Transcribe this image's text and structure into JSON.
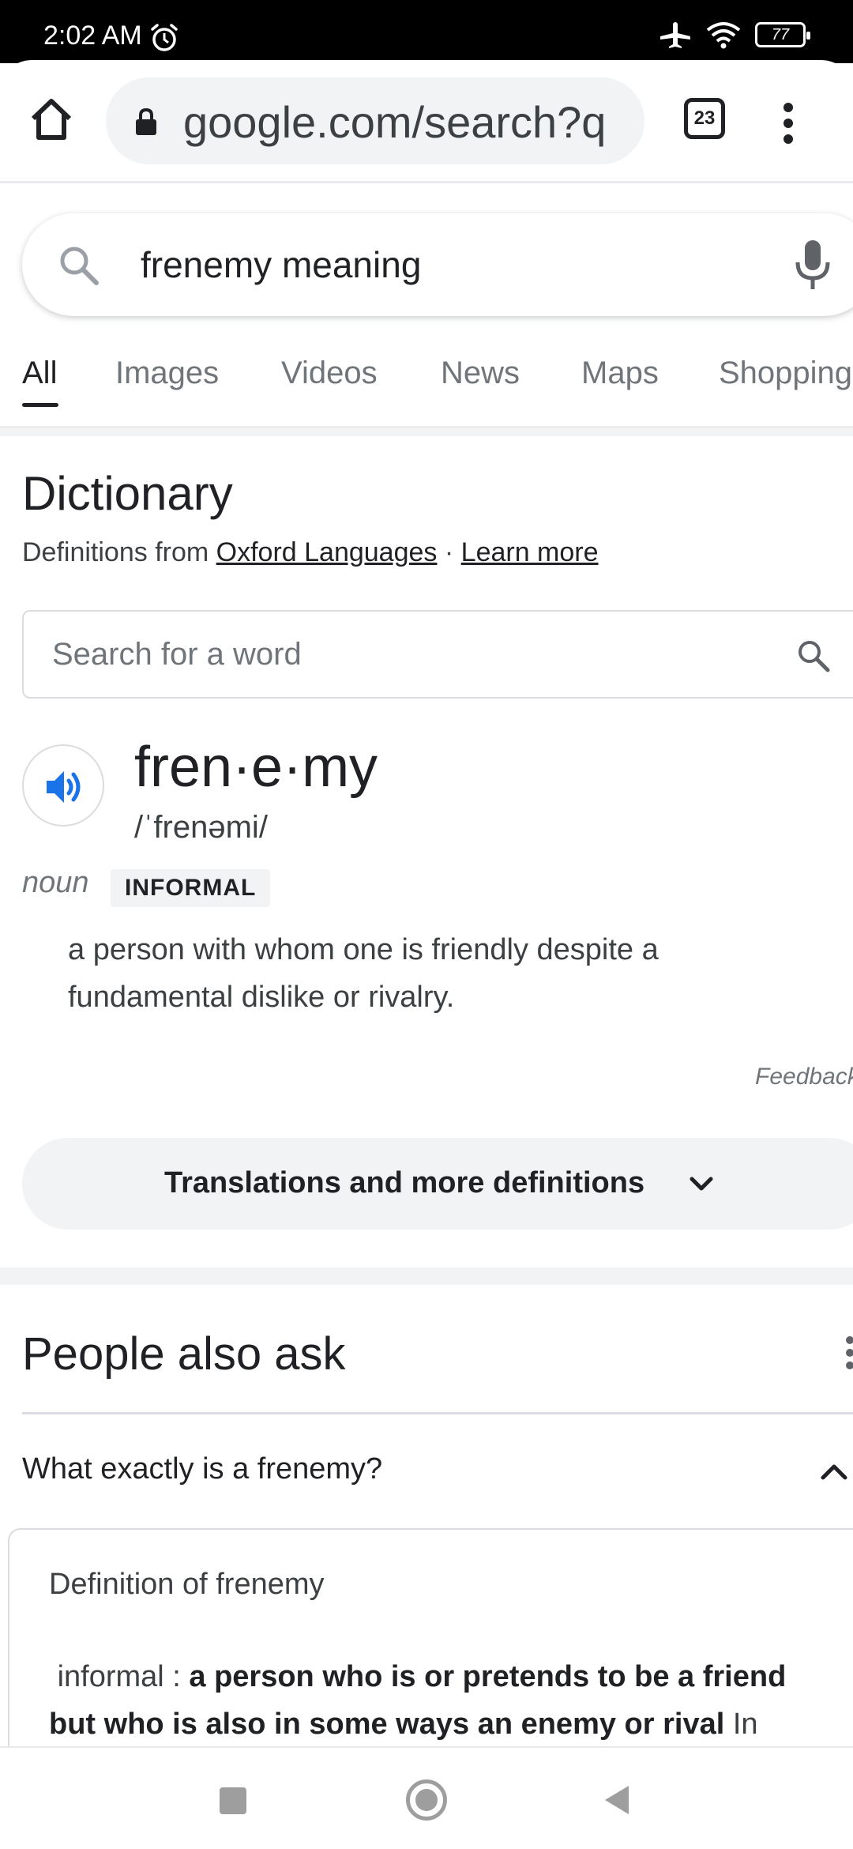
{
  "status_bar": {
    "time": "2:02 AM",
    "battery": "77",
    "icons": [
      "alarm-icon",
      "airplane-icon",
      "wifi-icon",
      "battery-icon"
    ]
  },
  "browser": {
    "url": "google.com/search?q",
    "tab_count": "23",
    "icons": [
      "home-icon",
      "lock-icon",
      "tabs-icon",
      "more-vert-icon"
    ]
  },
  "search": {
    "query": "frenemy meaning"
  },
  "tabs": [
    {
      "label": "All",
      "active": true
    },
    {
      "label": "Images",
      "active": false
    },
    {
      "label": "Videos",
      "active": false
    },
    {
      "label": "News",
      "active": false
    },
    {
      "label": "Maps",
      "active": false
    },
    {
      "label": "Shopping",
      "active": false
    }
  ],
  "dictionary": {
    "title": "Dictionary",
    "source_prefix": "Definitions from",
    "source_link": "Oxford Languages",
    "separator": "·",
    "learn_more": "Learn more",
    "word_search_placeholder": "Search for a word",
    "headword": "fren·e·my",
    "phonetic": "/ˈfrenəmi/",
    "part_of_speech": "noun",
    "register": "INFORMAL",
    "definition": "a person with whom one is friendly despite a fundamental dislike or rivalry.",
    "feedback": "Feedback",
    "more_button": "Translations and more definitions"
  },
  "people_also_ask": {
    "title": "People also ask",
    "question": "What exactly is a frenemy?",
    "answer_heading": "Definition of frenemy",
    "answer_prefix": "informal : ",
    "answer_bold": "a person who is or pretends to be a friend but who is also in some ways an enemy or rival",
    "answer_suffix": " In"
  },
  "colors": {
    "accent_blue": "#1a73e8",
    "text_primary": "#202124",
    "text_secondary": "#70757a",
    "chip_bg": "#f1f3f4"
  }
}
